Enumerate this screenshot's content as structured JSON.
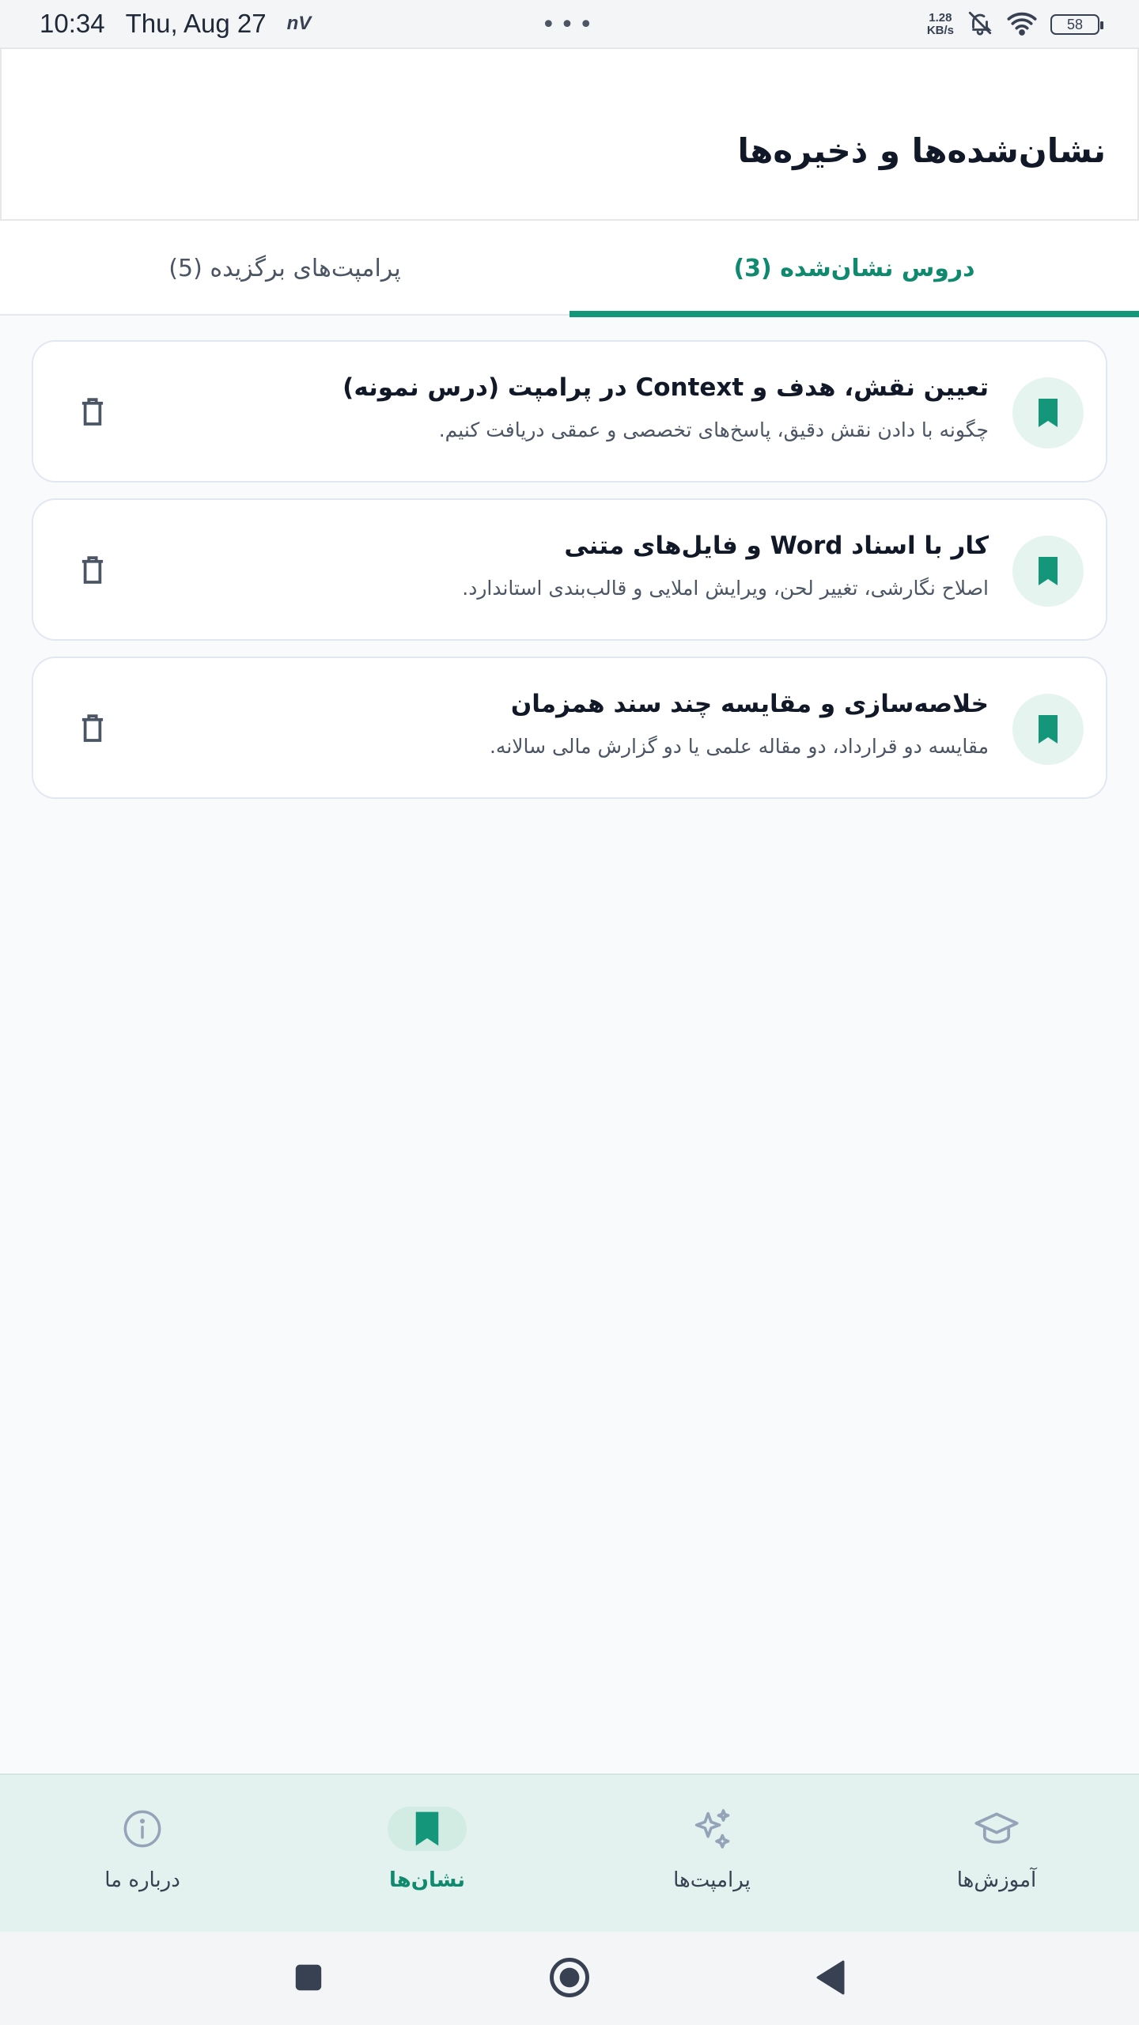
{
  "status_bar": {
    "time": "10:34",
    "date": "Thu, Aug 27",
    "carrier_icon_text": "nV",
    "dots": "•••",
    "speed_value": "1.28",
    "speed_unit": "KB/s",
    "battery": "58"
  },
  "header": {
    "title": "نشان‌شده‌ها و ذخیره‌ها"
  },
  "tabs": [
    {
      "label": "دروس نشان‌شده (3)",
      "active": true
    },
    {
      "label": "پرامپت‌های برگزیده (5)",
      "active": false
    }
  ],
  "cards": [
    {
      "title": "تعیین نقش، هدف و Context در پرامپت (درس نمونه)",
      "subtitle": "چگونه با دادن نقش دقیق، پاسخ‌های تخصصی و عمقی دریافت کنیم.",
      "icon": "bookmark-icon",
      "action_icon": "trash-icon"
    },
    {
      "title": "کار با اسناد Word و فایل‌های متنی",
      "subtitle": "اصلاح نگارشی، تغییر لحن، ویرایش املایی و قالب‌بندی استاندارد.",
      "icon": "bookmark-icon",
      "action_icon": "trash-icon"
    },
    {
      "title": "خلاصه‌سازی و مقایسه چند سند همزمان",
      "subtitle": "مقایسه دو قرارداد، دو مقاله علمی یا دو گزارش مالی سالانه.",
      "icon": "bookmark-icon",
      "action_icon": "trash-icon"
    }
  ],
  "bottom_nav": [
    {
      "label": "آموزش‌ها",
      "icon": "graduation-cap-icon",
      "active": false
    },
    {
      "label": "پرامپت‌ها",
      "icon": "sparkles-icon",
      "active": false
    },
    {
      "label": "نشان‌ها",
      "icon": "bookmark-icon",
      "active": true
    },
    {
      "label": "درباره ما",
      "icon": "info-icon",
      "active": false
    }
  ],
  "colors": {
    "accent": "#14967a",
    "accent_text": "#0f8a6e",
    "card_icon_bg": "#e6f4ef",
    "nav_bg": "#e3f2ee"
  }
}
